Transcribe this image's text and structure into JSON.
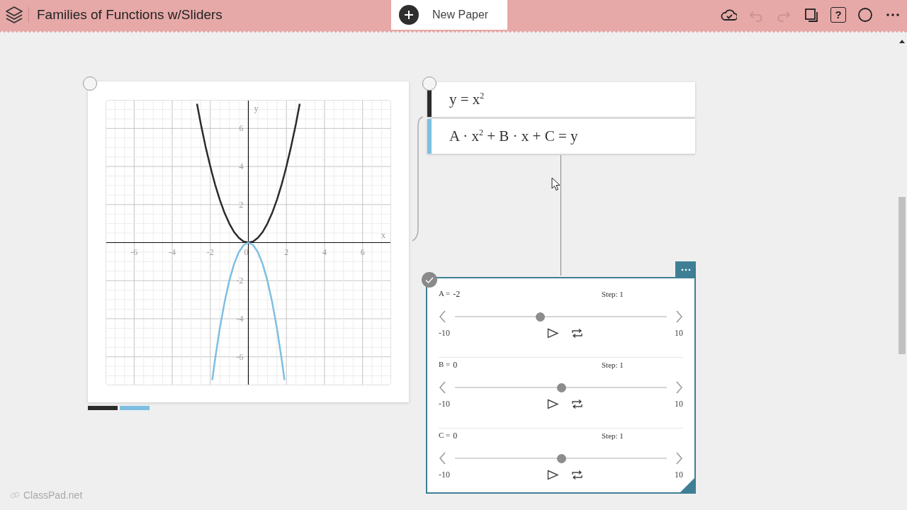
{
  "window": {
    "title": "Families of Functions w/Sliders"
  },
  "new_paper": {
    "label": "New Paper"
  },
  "toolbar": [
    {
      "kind": "cloud",
      "disabled": false
    },
    {
      "kind": "undo",
      "disabled": true
    },
    {
      "kind": "redo",
      "disabled": true
    },
    {
      "kind": "pages",
      "disabled": false
    },
    {
      "kind": "help",
      "label": "?",
      "disabled": false
    },
    {
      "kind": "circle",
      "disabled": false
    },
    {
      "kind": "more",
      "disabled": false
    }
  ],
  "graph": {
    "chart_data": {
      "type": "line",
      "grid": true,
      "xlabel": "x",
      "ylabel": "y",
      "xlim": [
        -7.5,
        7.5
      ],
      "ylim": [
        -7.5,
        7.5
      ],
      "xticks": [
        -6,
        -4,
        -2,
        0,
        2,
        4,
        6
      ],
      "yticks": [
        -6,
        -4,
        -2,
        2,
        4,
        6
      ],
      "x": [
        -2.7,
        -2.5,
        -2.25,
        -2,
        -1.9,
        -1.75,
        -1.5,
        -1.25,
        -1,
        -0.75,
        -0.5,
        -0.25,
        0,
        0.25,
        0.5,
        0.75,
        1,
        1.25,
        1.5,
        1.75,
        1.9,
        2,
        2.25,
        2.5,
        2.7
      ],
      "series": [
        {
          "color": "#2b2b2b",
          "values": [
            7.29,
            6.25,
            5.06,
            4,
            3.61,
            3.06,
            2.25,
            1.56,
            1,
            0.56,
            0.25,
            0.06,
            0,
            0.06,
            0.25,
            0.56,
            1,
            1.56,
            2.25,
            3.06,
            3.61,
            4,
            5.06,
            6.25,
            7.29
          ]
        },
        {
          "color": "#7dbfe2",
          "values": [
            null,
            null,
            null,
            null,
            -7.22,
            -6.13,
            -4.5,
            -3.13,
            -2,
            -1.13,
            -0.5,
            -0.13,
            0,
            -0.13,
            -0.5,
            -1.13,
            -2,
            -3.13,
            -4.5,
            -6.13,
            -7.22,
            null,
            null,
            null,
            null
          ]
        }
      ]
    }
  },
  "expressions": [
    {
      "text": "y = x$^{2}$",
      "color": "#2b2b2b"
    },
    {
      "text": "A · x$^{2}$ + B · x + C = y",
      "color": "#7dbfe2"
    }
  ],
  "sliders": [
    {
      "name": "A =",
      "value": "-2",
      "step": "Step: 1",
      "min": "-10",
      "max": "10",
      "level": 0.4
    },
    {
      "name": "B =",
      "value": "0",
      "step": "Step: 1",
      "min": "-10",
      "max": "10",
      "level": 0.5
    },
    {
      "name": "C =",
      "value": "0",
      "step": "Step: 1",
      "min": "-10",
      "max": "10",
      "level": 0.5
    }
  ],
  "branding": {
    "text": "ClassPad.net"
  }
}
